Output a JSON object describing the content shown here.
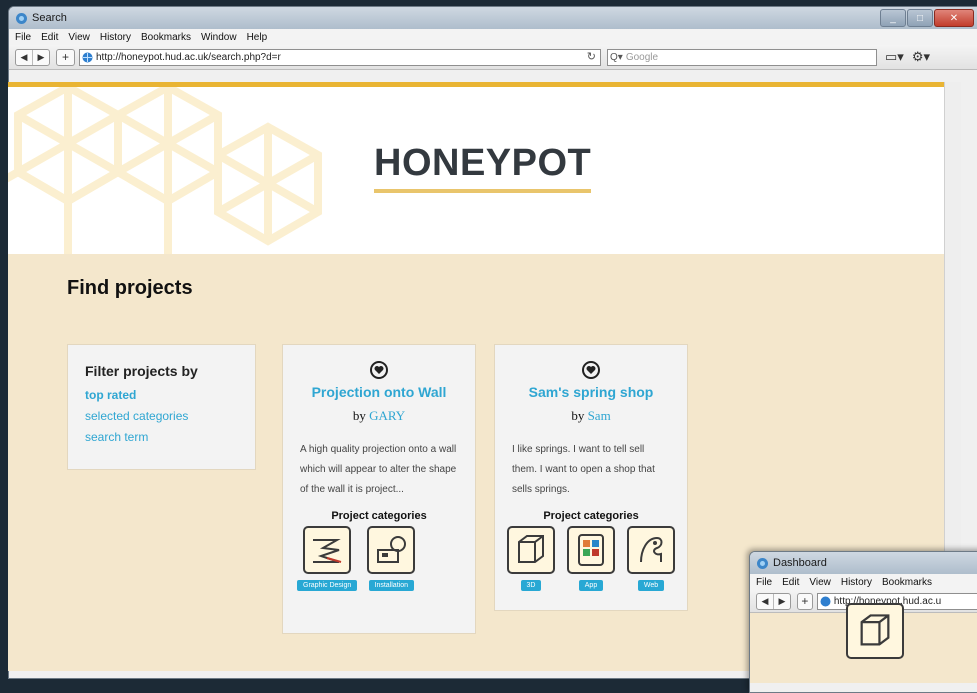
{
  "window": {
    "title": "Search",
    "menu": [
      "File",
      "Edit",
      "View",
      "History",
      "Bookmarks",
      "Window",
      "Help"
    ],
    "url": "http://honeypot.hud.ac.uk/search.php?d=r",
    "search_placeholder": "Google"
  },
  "site": {
    "brand": "HONEYPOT",
    "heading": "Find projects",
    "filter": {
      "title": "Filter projects by",
      "options": [
        "top rated",
        "selected categories",
        "search term"
      ]
    },
    "projects": [
      {
        "title": "Projection onto Wall",
        "by": "by",
        "author": "GARY",
        "description": "A high quality projection onto a wall which will appear to alter the shape of the wall it is project...",
        "categories_label": "Project categories",
        "categories": [
          "Graphic Design",
          "Installation"
        ]
      },
      {
        "title": "Sam's spring shop",
        "by": "by",
        "author": "Sam",
        "description": "I like springs. I want to tell sell them. I want to open a shop that sells springs.",
        "categories_label": "Project categories",
        "categories": [
          "3D",
          "App",
          "Web"
        ]
      }
    ]
  },
  "second_window": {
    "title": "Dashboard",
    "menu": [
      "File",
      "Edit",
      "View",
      "History",
      "Bookmarks"
    ],
    "url": "http://honeypot.hud.ac.u"
  },
  "colors": {
    "accent": "#2fa6d2",
    "gold": "#e9b433",
    "page_bg": "#f4e7cc"
  }
}
